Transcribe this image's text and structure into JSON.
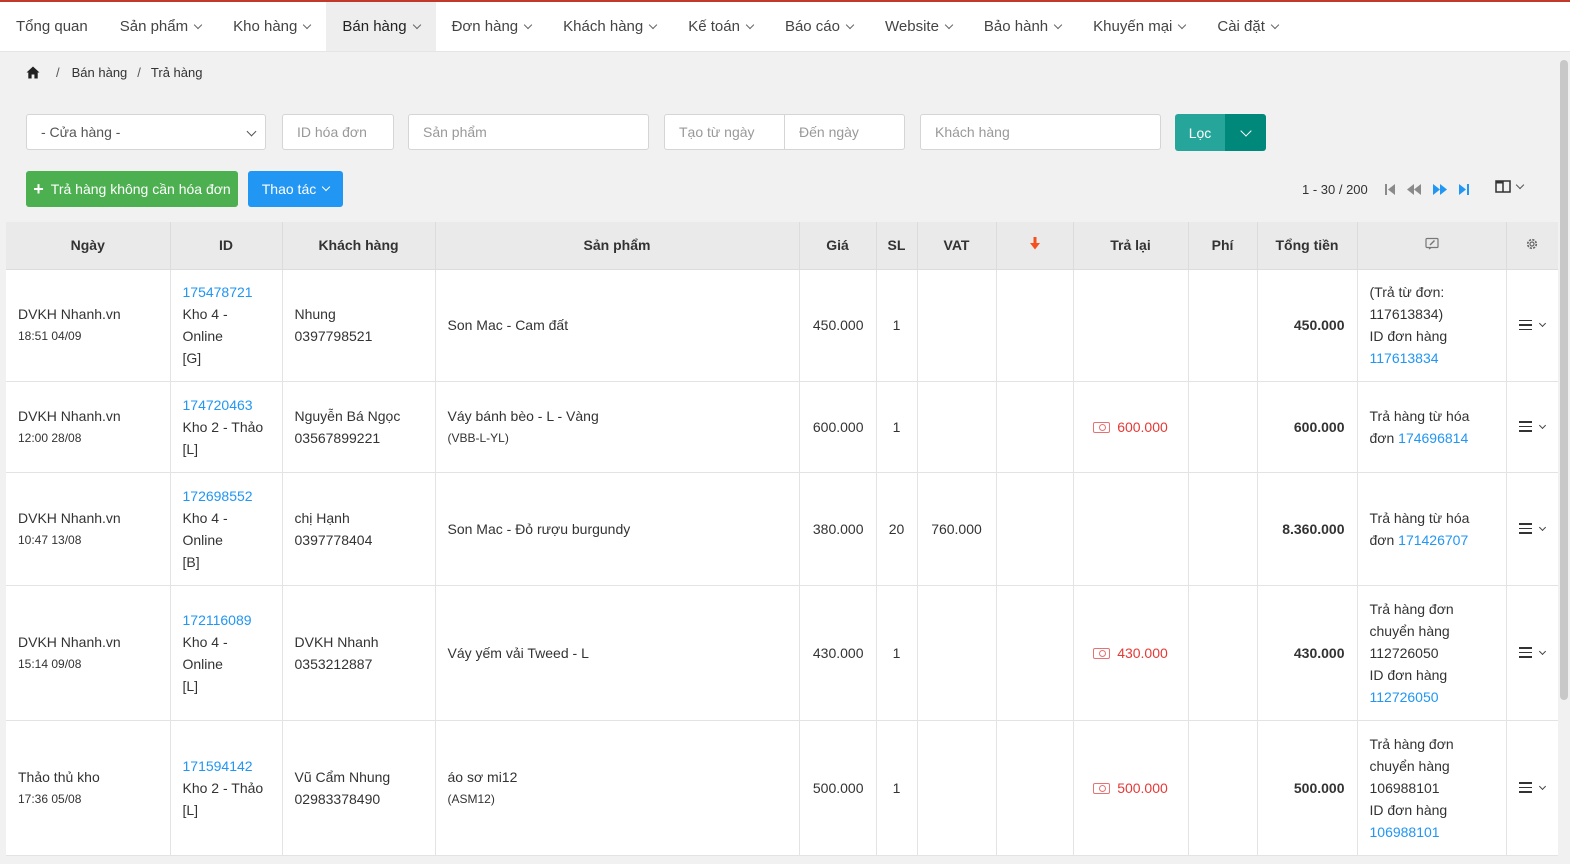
{
  "nav": {
    "items": [
      {
        "label": "Tổng quan",
        "dropdown": false
      },
      {
        "label": "Sản phẩm",
        "dropdown": true
      },
      {
        "label": "Kho hàng",
        "dropdown": true
      },
      {
        "label": "Bán hàng",
        "dropdown": true,
        "active": true
      },
      {
        "label": "Đơn hàng",
        "dropdown": true
      },
      {
        "label": "Khách hàng",
        "dropdown": true
      },
      {
        "label": "Kế toán",
        "dropdown": true
      },
      {
        "label": "Báo cáo",
        "dropdown": true
      },
      {
        "label": "Website",
        "dropdown": true
      },
      {
        "label": "Bảo hành",
        "dropdown": true
      },
      {
        "label": "Khuyến mại",
        "dropdown": true
      },
      {
        "label": "Cài đặt",
        "dropdown": true
      }
    ]
  },
  "breadcrumb": {
    "home_icon": "home-icon",
    "level1": "Bán hàng",
    "level2": "Trả hàng"
  },
  "filters": {
    "store_select": "- Cửa hàng -",
    "invoice_id_placeholder": "ID hóa đơn",
    "product_placeholder": "Sản phẩm",
    "from_date_placeholder": "Tạo từ ngày",
    "to_date_placeholder": "Đến ngày",
    "customer_placeholder": "Khách hàng",
    "filter_label": "Lọc"
  },
  "actions": {
    "return_no_invoice_label": "Trả hàng không cần hóa đơn",
    "operations_label": "Thao tác"
  },
  "pagination": {
    "info": "1 - 30 / 200"
  },
  "colors": {
    "accent_green": "#4caf50",
    "accent_blue": "#2196f3",
    "filter_teal": "#26a69a",
    "link": "#2196f3",
    "refund_red": "#e53935",
    "top_border": "#c0392b"
  },
  "table": {
    "headers": {
      "date": "Ngày",
      "id": "ID",
      "customer": "Khách hàng",
      "product": "Sản phẩm",
      "price": "Giá",
      "qty": "SL",
      "vat": "VAT",
      "sort_icon": "arrow-down-icon",
      "refund": "Trả lại",
      "fee": "Phí",
      "total": "Tổng tiền",
      "note_icon": "edit-note-icon",
      "settings_icon": "gear-icon"
    },
    "rows": [
      {
        "creator": "DVKH Nhanh.vn",
        "datetime": "18:51 04/09",
        "id": "175478721",
        "store": "Kho 4 - Online",
        "tag": "[G]",
        "customer_name": "Nhung",
        "customer_phone": "0397798521",
        "product": "Son Mac - Cam đất",
        "product_code": "",
        "price": "450.000",
        "qty": "1",
        "vat": "",
        "refund": "",
        "fee": "",
        "total": "450.000",
        "note_text1": "(Trả từ đơn: 117613834)",
        "note_text2": "ID đơn hàng",
        "note_link": "117613834"
      },
      {
        "creator": "DVKH Nhanh.vn",
        "datetime": "12:00 28/08",
        "id": "174720463",
        "store": "Kho 2 - Thảo",
        "tag": "[L]",
        "customer_name": "Nguyễn Bá Ngọc",
        "customer_phone": "03567899221",
        "product": "Váy bánh bèo - L - Vàng",
        "product_code": "(VBB-L-YL)",
        "price": "600.000",
        "qty": "1",
        "vat": "",
        "refund": "600.000",
        "fee": "",
        "total": "600.000",
        "note_text1": "Trả hàng từ hóa đơn",
        "note_text2": "",
        "note_link": "174696814"
      },
      {
        "creator": "DVKH Nhanh.vn",
        "datetime": "10:47 13/08",
        "id": "172698552",
        "store": "Kho 4 - Online",
        "tag": "[B]",
        "customer_name": "chị Hạnh",
        "customer_phone": "0397778404",
        "product": "Son Mac - Đỏ rượu burgundy",
        "product_code": "",
        "price": "380.000",
        "qty": "20",
        "vat": "760.000",
        "refund": "",
        "fee": "",
        "total": "8.360.000",
        "note_text1": "Trả hàng từ hóa đơn",
        "note_text2": "",
        "note_link": "171426707"
      },
      {
        "creator": "DVKH Nhanh.vn",
        "datetime": "15:14 09/08",
        "id": "172116089",
        "store": "Kho 4 - Online",
        "tag": "[L]",
        "customer_name": "DVKH Nhanh",
        "customer_phone": "0353212887",
        "product": "Váy yếm vải Tweed - L",
        "product_code": "",
        "price": "430.000",
        "qty": "1",
        "vat": "",
        "refund": "430.000",
        "fee": "",
        "total": "430.000",
        "note_text1": "Trả hàng đơn chuyển hàng 112726050",
        "note_text2": "ID đơn hàng",
        "note_link": "112726050"
      },
      {
        "creator": "Thảo thủ kho",
        "datetime": "17:36 05/08",
        "id": "171594142",
        "store": "Kho 2 - Thảo",
        "tag": "[L]",
        "customer_name": "Vũ Cẩm Nhung",
        "customer_phone": "02983378490",
        "product": "áo sơ mi12",
        "product_code": "(ASM12)",
        "price": "500.000",
        "qty": "1",
        "vat": "",
        "refund": "500.000",
        "fee": "",
        "total": "500.000",
        "note_text1": "Trả hàng đơn chuyển hàng 106988101",
        "note_text2": "ID đơn hàng",
        "note_link": "106988101"
      }
    ]
  }
}
